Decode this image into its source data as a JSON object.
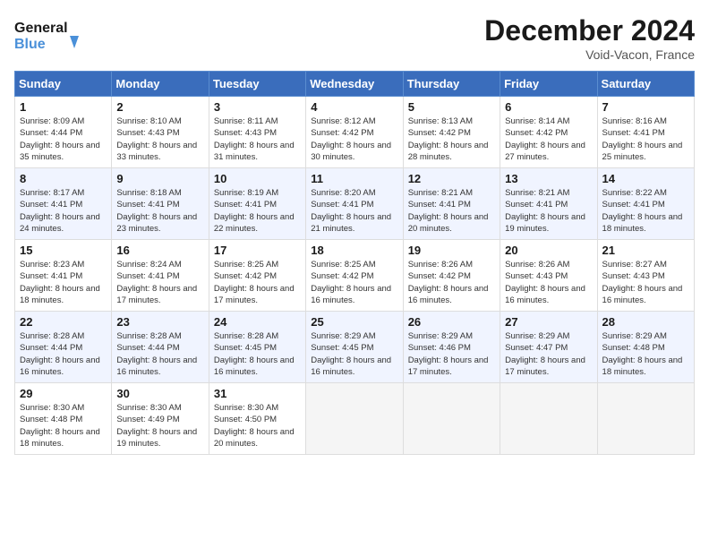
{
  "header": {
    "logo_line1": "General",
    "logo_line2": "Blue",
    "month": "December 2024",
    "location": "Void-Vacon, France"
  },
  "columns": [
    "Sunday",
    "Monday",
    "Tuesday",
    "Wednesday",
    "Thursday",
    "Friday",
    "Saturday"
  ],
  "weeks": [
    [
      {
        "day": "1",
        "sunrise": "Sunrise: 8:09 AM",
        "sunset": "Sunset: 4:44 PM",
        "daylight": "Daylight: 8 hours and 35 minutes."
      },
      {
        "day": "2",
        "sunrise": "Sunrise: 8:10 AM",
        "sunset": "Sunset: 4:43 PM",
        "daylight": "Daylight: 8 hours and 33 minutes."
      },
      {
        "day": "3",
        "sunrise": "Sunrise: 8:11 AM",
        "sunset": "Sunset: 4:43 PM",
        "daylight": "Daylight: 8 hours and 31 minutes."
      },
      {
        "day": "4",
        "sunrise": "Sunrise: 8:12 AM",
        "sunset": "Sunset: 4:42 PM",
        "daylight": "Daylight: 8 hours and 30 minutes."
      },
      {
        "day": "5",
        "sunrise": "Sunrise: 8:13 AM",
        "sunset": "Sunset: 4:42 PM",
        "daylight": "Daylight: 8 hours and 28 minutes."
      },
      {
        "day": "6",
        "sunrise": "Sunrise: 8:14 AM",
        "sunset": "Sunset: 4:42 PM",
        "daylight": "Daylight: 8 hours and 27 minutes."
      },
      {
        "day": "7",
        "sunrise": "Sunrise: 8:16 AM",
        "sunset": "Sunset: 4:41 PM",
        "daylight": "Daylight: 8 hours and 25 minutes."
      }
    ],
    [
      {
        "day": "8",
        "sunrise": "Sunrise: 8:17 AM",
        "sunset": "Sunset: 4:41 PM",
        "daylight": "Daylight: 8 hours and 24 minutes."
      },
      {
        "day": "9",
        "sunrise": "Sunrise: 8:18 AM",
        "sunset": "Sunset: 4:41 PM",
        "daylight": "Daylight: 8 hours and 23 minutes."
      },
      {
        "day": "10",
        "sunrise": "Sunrise: 8:19 AM",
        "sunset": "Sunset: 4:41 PM",
        "daylight": "Daylight: 8 hours and 22 minutes."
      },
      {
        "day": "11",
        "sunrise": "Sunrise: 8:20 AM",
        "sunset": "Sunset: 4:41 PM",
        "daylight": "Daylight: 8 hours and 21 minutes."
      },
      {
        "day": "12",
        "sunrise": "Sunrise: 8:21 AM",
        "sunset": "Sunset: 4:41 PM",
        "daylight": "Daylight: 8 hours and 20 minutes."
      },
      {
        "day": "13",
        "sunrise": "Sunrise: 8:21 AM",
        "sunset": "Sunset: 4:41 PM",
        "daylight": "Daylight: 8 hours and 19 minutes."
      },
      {
        "day": "14",
        "sunrise": "Sunrise: 8:22 AM",
        "sunset": "Sunset: 4:41 PM",
        "daylight": "Daylight: 8 hours and 18 minutes."
      }
    ],
    [
      {
        "day": "15",
        "sunrise": "Sunrise: 8:23 AM",
        "sunset": "Sunset: 4:41 PM",
        "daylight": "Daylight: 8 hours and 18 minutes."
      },
      {
        "day": "16",
        "sunrise": "Sunrise: 8:24 AM",
        "sunset": "Sunset: 4:41 PM",
        "daylight": "Daylight: 8 hours and 17 minutes."
      },
      {
        "day": "17",
        "sunrise": "Sunrise: 8:25 AM",
        "sunset": "Sunset: 4:42 PM",
        "daylight": "Daylight: 8 hours and 17 minutes."
      },
      {
        "day": "18",
        "sunrise": "Sunrise: 8:25 AM",
        "sunset": "Sunset: 4:42 PM",
        "daylight": "Daylight: 8 hours and 16 minutes."
      },
      {
        "day": "19",
        "sunrise": "Sunrise: 8:26 AM",
        "sunset": "Sunset: 4:42 PM",
        "daylight": "Daylight: 8 hours and 16 minutes."
      },
      {
        "day": "20",
        "sunrise": "Sunrise: 8:26 AM",
        "sunset": "Sunset: 4:43 PM",
        "daylight": "Daylight: 8 hours and 16 minutes."
      },
      {
        "day": "21",
        "sunrise": "Sunrise: 8:27 AM",
        "sunset": "Sunset: 4:43 PM",
        "daylight": "Daylight: 8 hours and 16 minutes."
      }
    ],
    [
      {
        "day": "22",
        "sunrise": "Sunrise: 8:28 AM",
        "sunset": "Sunset: 4:44 PM",
        "daylight": "Daylight: 8 hours and 16 minutes."
      },
      {
        "day": "23",
        "sunrise": "Sunrise: 8:28 AM",
        "sunset": "Sunset: 4:44 PM",
        "daylight": "Daylight: 8 hours and 16 minutes."
      },
      {
        "day": "24",
        "sunrise": "Sunrise: 8:28 AM",
        "sunset": "Sunset: 4:45 PM",
        "daylight": "Daylight: 8 hours and 16 minutes."
      },
      {
        "day": "25",
        "sunrise": "Sunrise: 8:29 AM",
        "sunset": "Sunset: 4:45 PM",
        "daylight": "Daylight: 8 hours and 16 minutes."
      },
      {
        "day": "26",
        "sunrise": "Sunrise: 8:29 AM",
        "sunset": "Sunset: 4:46 PM",
        "daylight": "Daylight: 8 hours and 17 minutes."
      },
      {
        "day": "27",
        "sunrise": "Sunrise: 8:29 AM",
        "sunset": "Sunset: 4:47 PM",
        "daylight": "Daylight: 8 hours and 17 minutes."
      },
      {
        "day": "28",
        "sunrise": "Sunrise: 8:29 AM",
        "sunset": "Sunset: 4:48 PM",
        "daylight": "Daylight: 8 hours and 18 minutes."
      }
    ],
    [
      {
        "day": "29",
        "sunrise": "Sunrise: 8:30 AM",
        "sunset": "Sunset: 4:48 PM",
        "daylight": "Daylight: 8 hours and 18 minutes."
      },
      {
        "day": "30",
        "sunrise": "Sunrise: 8:30 AM",
        "sunset": "Sunset: 4:49 PM",
        "daylight": "Daylight: 8 hours and 19 minutes."
      },
      {
        "day": "31",
        "sunrise": "Sunrise: 8:30 AM",
        "sunset": "Sunset: 4:50 PM",
        "daylight": "Daylight: 8 hours and 20 minutes."
      },
      null,
      null,
      null,
      null
    ]
  ]
}
